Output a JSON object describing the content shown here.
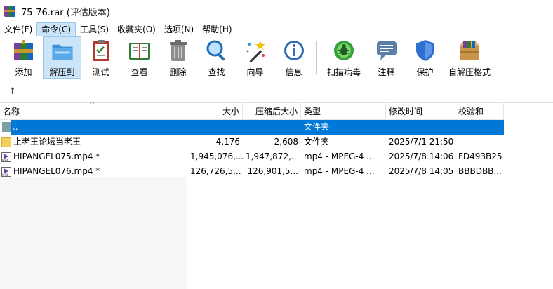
{
  "window": {
    "title": "75-76.rar (评估版本)"
  },
  "menu": [
    {
      "label": "文件(F)"
    },
    {
      "label": "命令(C)",
      "active": true
    },
    {
      "label": "工具(S)"
    },
    {
      "label": "收藏夹(O)"
    },
    {
      "label": "选项(N)"
    },
    {
      "label": "帮助(H)"
    }
  ],
  "toolbar": [
    {
      "label": "添加",
      "icon": "books-add-icon"
    },
    {
      "label": "解压到",
      "icon": "folder-extract-icon",
      "active": true
    },
    {
      "label": "测试",
      "icon": "clipboard-test-icon"
    },
    {
      "label": "查看",
      "icon": "book-view-icon"
    },
    {
      "label": "删除",
      "icon": "trash-icon"
    },
    {
      "label": "查找",
      "icon": "magnifier-icon"
    },
    {
      "label": "向导",
      "icon": "wizard-wand-icon"
    },
    {
      "label": "信息",
      "icon": "info-icon"
    },
    {
      "label": "扫描病毒",
      "icon": "virus-scan-icon"
    },
    {
      "label": "注释",
      "icon": "comment-icon"
    },
    {
      "label": "保护",
      "icon": "shield-icon"
    },
    {
      "label": "自解压格式",
      "icon": "sfx-box-icon"
    }
  ],
  "up_arrow": "↑",
  "columns": {
    "name": "名称",
    "size": "大小",
    "packed": "压缩后大小",
    "type": "类型",
    "modified": "修改时间",
    "crc": "校验和"
  },
  "rows": [
    {
      "name": "..",
      "size": "",
      "packed": "",
      "type": "文件夹",
      "modified": "",
      "crc": "",
      "icon": "parent-folder-icon",
      "selected": true
    },
    {
      "name": "上老王论坛当老王",
      "size": "4,176",
      "packed": "2,608",
      "type": "文件夹",
      "modified": "2025/7/1 21:50",
      "crc": "",
      "icon": "folder-icon"
    },
    {
      "name": "HIPANGEL075.mp4 *",
      "size": "1,945,076,...",
      "packed": "1,947,872,...",
      "type": "mp4 - MPEG-4 ...",
      "modified": "2025/7/8 14:06",
      "crc": "FD493B25",
      "icon": "mp4-file-icon"
    },
    {
      "name": "HIPANGEL076.mp4 *",
      "size": "126,726,5...",
      "packed": "126,901,5...",
      "type": "mp4 - MPEG-4 ...",
      "modified": "2025/7/8 14:05",
      "crc": "BBBDBB...",
      "icon": "mp4-file-icon"
    }
  ]
}
